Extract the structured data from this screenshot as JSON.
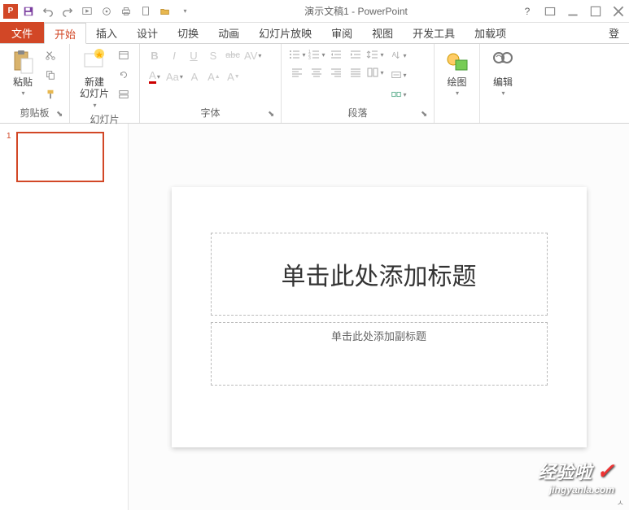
{
  "title": "演示文稿1 - PowerPoint",
  "tabs": {
    "file": "文件",
    "home": "开始",
    "insert": "插入",
    "design": "设计",
    "transitions": "切换",
    "animations": "动画",
    "slideshow": "幻灯片放映",
    "review": "审阅",
    "view": "视图",
    "developer": "开发工具",
    "addins": "加载项",
    "login": "登"
  },
  "ribbon": {
    "clipboard": {
      "label": "剪贴板",
      "paste": "粘贴"
    },
    "slides": {
      "label": "幻灯片",
      "new_slide": "新建\n幻灯片"
    },
    "font": {
      "label": "字体",
      "B": "B",
      "I": "I",
      "U": "U",
      "S": "S",
      "abc": "abc",
      "AV": "AV",
      "A_big": "A",
      "Aa": "Aa",
      "A_clear": "A",
      "A_up": "A",
      "A_down": "A"
    },
    "paragraph": {
      "label": "段落"
    },
    "drawing": {
      "label": "绘图"
    },
    "editing": {
      "label": "编辑"
    }
  },
  "slide": {
    "number": "1",
    "title_placeholder": "单击此处添加标题",
    "subtitle_placeholder": "单击此处添加副标题"
  },
  "watermark": {
    "main": "经验啦",
    "sub": "jingyanla.com",
    "check": "✓"
  }
}
